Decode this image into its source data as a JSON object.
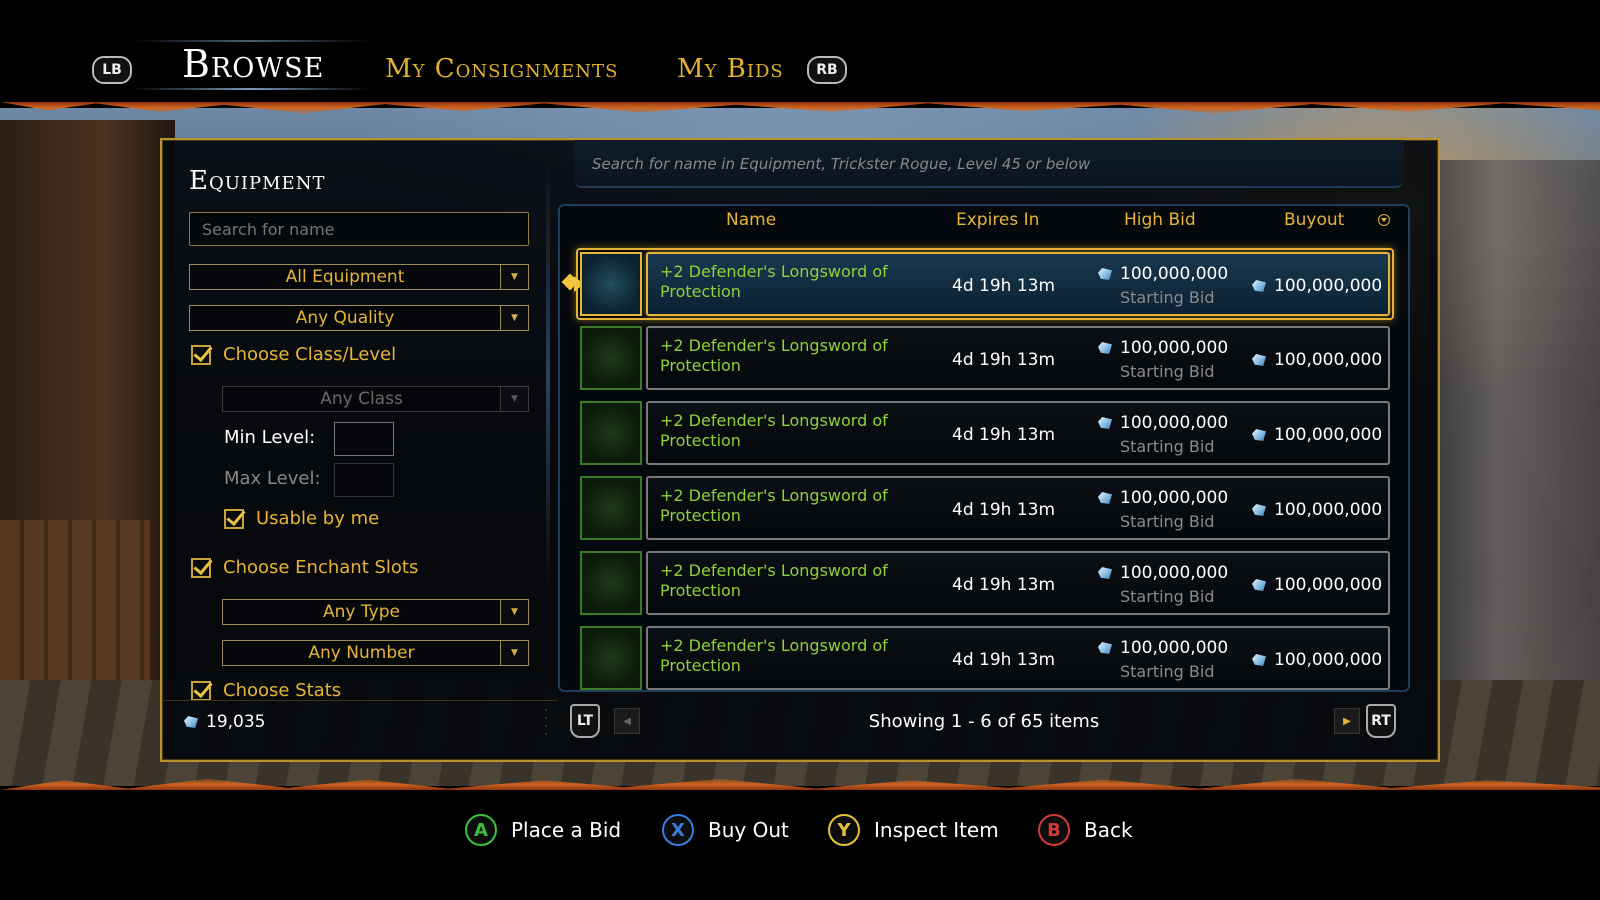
{
  "tabs": {
    "lb": "LB",
    "rb": "RB",
    "browse": "Browse",
    "consignments": "My Consignments",
    "bids": "My Bids"
  },
  "left_panel": {
    "title": "Equipment",
    "search_placeholder": "Search for name",
    "equipment_dropdown": "All Equipment",
    "quality_dropdown": "Any Quality",
    "choose_class_label": "Choose Class/Level",
    "class_dropdown": "Any Class",
    "min_level_label": "Min Level:",
    "max_level_label": "Max Level:",
    "usable_label": "Usable by me",
    "choose_enchant_label": "Choose Enchant Slots",
    "type_dropdown": "Any Type",
    "number_dropdown": "Any Number",
    "choose_stats_label": "Choose Stats",
    "currency": "19,035"
  },
  "query": "Search for name in Equipment, Trickster Rogue, Level 45 or below",
  "table": {
    "headers": {
      "name": "Name",
      "expires": "Expires In",
      "high_bid": "High Bid",
      "buyout": "Buyout"
    },
    "rows": [
      {
        "name": "+2 Defender's Longsword of Protection",
        "expires": "4d 19h 13m",
        "bid": "100,000,000",
        "bid_sub": "Starting Bid",
        "buyout": "100,000,000"
      },
      {
        "name": "+2 Defender's Longsword of Protection",
        "expires": "4d 19h 13m",
        "bid": "100,000,000",
        "bid_sub": "Starting Bid",
        "buyout": "100,000,000"
      },
      {
        "name": "+2 Defender's Longsword of Protection",
        "expires": "4d 19h 13m",
        "bid": "100,000,000",
        "bid_sub": "Starting Bid",
        "buyout": "100,000,000"
      },
      {
        "name": "+2 Defender's Longsword of Protection",
        "expires": "4d 19h 13m",
        "bid": "100,000,000",
        "bid_sub": "Starting Bid",
        "buyout": "100,000,000"
      },
      {
        "name": "+2 Defender's Longsword of Protection",
        "expires": "4d 19h 13m",
        "bid": "100,000,000",
        "bid_sub": "Starting Bid",
        "buyout": "100,000,000"
      },
      {
        "name": "+2 Defender's Longsword of Protection",
        "expires": "4d 19h 13m",
        "bid": "100,000,000",
        "bid_sub": "Starting Bid",
        "buyout": "100,000,000"
      }
    ]
  },
  "pager": {
    "lt": "LT",
    "rt": "RT",
    "status": "Showing 1 - 6 of 65 items"
  },
  "actions": [
    {
      "button": "A",
      "label": "Place a Bid",
      "color": "#3fbf3f"
    },
    {
      "button": "X",
      "label": "Buy Out",
      "color": "#3a7de0"
    },
    {
      "button": "Y",
      "label": "Inspect Item",
      "color": "#e6c23a"
    },
    {
      "button": "B",
      "label": "Back",
      "color": "#d23a3a"
    }
  ],
  "colors": {
    "accent_gold": "#e6b437",
    "item_green": "#8fd13a"
  }
}
